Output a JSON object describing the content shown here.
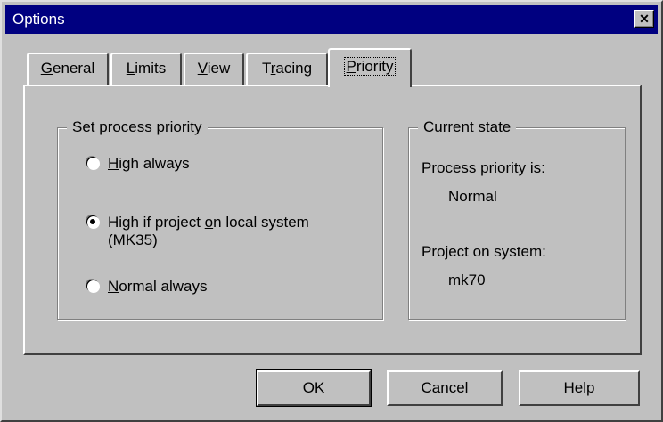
{
  "window": {
    "title": "Options",
    "close_glyph": "✕"
  },
  "tabs": [
    {
      "pre": "",
      "key": "G",
      "post": "eneral"
    },
    {
      "pre": "",
      "key": "L",
      "post": "imits"
    },
    {
      "pre": "",
      "key": "V",
      "post": "iew"
    },
    {
      "pre": "T",
      "key": "r",
      "post": "acing"
    },
    {
      "pre": "",
      "key": "P",
      "post": "riority"
    }
  ],
  "priority_group": {
    "legend": "Set process priority",
    "options": [
      {
        "key": "H",
        "rest": "igh always",
        "checked": false
      },
      {
        "pre": "High if project ",
        "key": "o",
        "rest": "n local system",
        "line2": "(MK35)",
        "checked": true
      },
      {
        "key": "N",
        "rest": "ormal always",
        "checked": false
      }
    ]
  },
  "state_group": {
    "legend": "Current state",
    "priority_label": "Process priority is:",
    "priority_value": "Normal",
    "system_label": "Project on system:",
    "system_value": "mk70"
  },
  "buttons": {
    "ok": "OK",
    "cancel": "Cancel",
    "help_key": "H",
    "help_rest": "elp"
  }
}
